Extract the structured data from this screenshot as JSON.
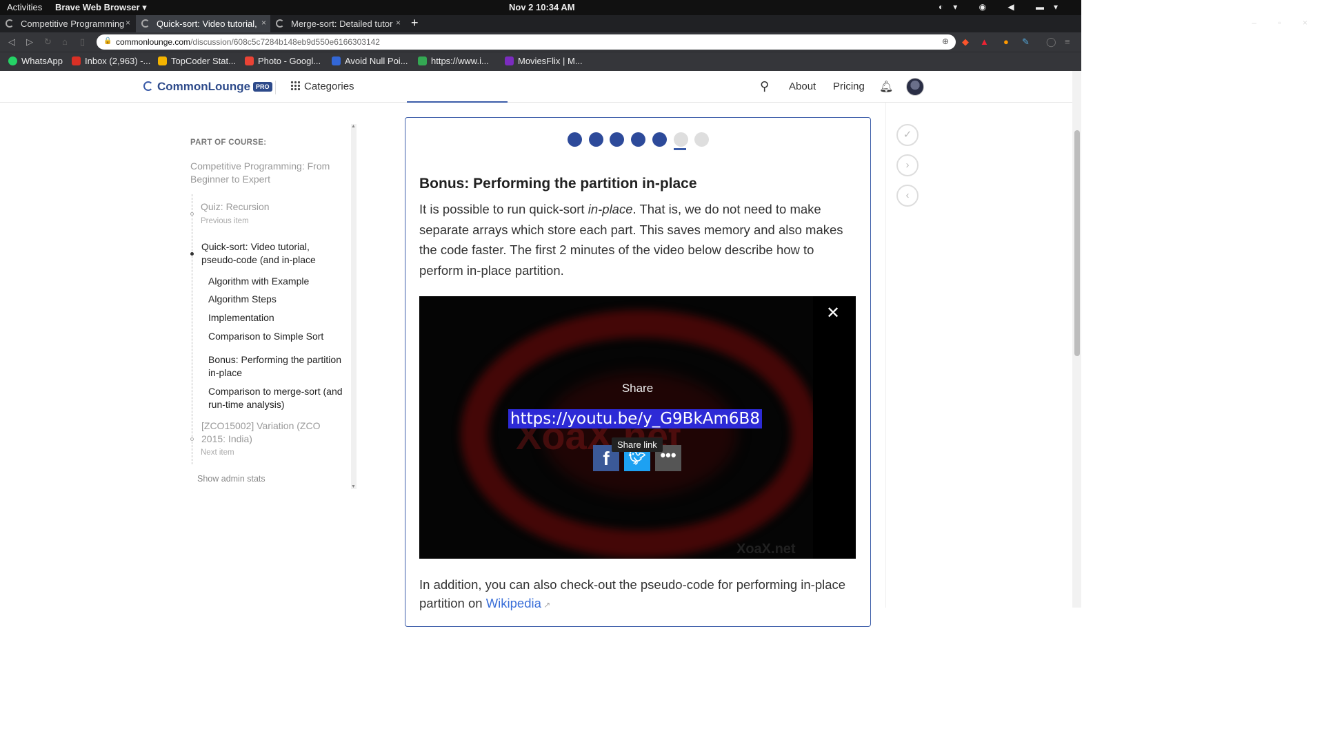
{
  "os": {
    "activities": "Activities",
    "app_menu": "Brave Web Browser ▾",
    "clock": "Nov 2  10:34 AM",
    "tray": "◐▾ ◉ ◀ ▬▾"
  },
  "browser": {
    "tabs": [
      {
        "label": "Competitive Programming",
        "active": false
      },
      {
        "label": "Quick-sort: Video tutorial,",
        "active": true
      },
      {
        "label": "Merge-sort: Detailed tutor",
        "active": false
      }
    ],
    "tab_close": "×",
    "new_tab": "+",
    "window_buttons": "– ▫ ×",
    "url_host": "commonlounge.com",
    "url_path": "/discussion/608c5c7284b148eb9d550e6166303142",
    "bookmarks": [
      {
        "label": "WhatsApp",
        "color": "#25d366"
      },
      {
        "label": "Inbox (2,963) -...",
        "color": "#d93025"
      },
      {
        "label": "TopCoder Stat...",
        "color": "#f4b400"
      },
      {
        "label": "Photo - Googl...",
        "color": "#ea4335"
      },
      {
        "label": "Avoid Null Poi...",
        "color": "#3367d6"
      },
      {
        "label": "https://www.i...",
        "color": "#34a853"
      },
      {
        "label": "MoviesFlix | M...",
        "color": "#7b2cbf"
      }
    ]
  },
  "site": {
    "logo": "CommonLounge",
    "pro_badge": "PRO",
    "categories": "Categories",
    "about": "About",
    "pricing": "Pricing"
  },
  "sidebar": {
    "part_of_course": "PART OF COURSE:",
    "course_title": "Competitive Programming: From Beginner to Expert",
    "prev_item": "Quiz: Recursion",
    "prev_label": "Previous item",
    "current_item": "Quick-sort: Video tutorial, pseudo-code (and in-place",
    "sections": [
      "Algorithm with Example",
      "Algorithm Steps",
      "Implementation",
      "Comparison to Simple Sort",
      "Bonus: Performing the partition in-place",
      "Comparison to merge-sort (and run-time analysis)"
    ],
    "next_item": "[ZCO15002] Variation (ZCO 2015: India)",
    "next_label": "Next item",
    "admin_stats": "Show admin stats"
  },
  "content": {
    "progress_dots": {
      "completed": 5,
      "total": 7,
      "current_index": 5
    },
    "heading": "Bonus: Performing the partition in-place",
    "para_before": "It is possible to run quick-sort ",
    "para_em": "in-place",
    "para_after": ". That is, we do not need to make separate arrays which store each part. This saves memory and also makes the code faster. The first 2 minutes of the video below describe how to perform in-place partition.",
    "video": {
      "share_label": "Share",
      "share_url": "https://youtu.be/y_G9BkAm6B8",
      "tooltip": "Share link",
      "watermark": "XoaX.net"
    },
    "para2_text": "In addition, you can also check-out the pseudo-code for performing in-place partition on ",
    "para2_link": "Wikipedia"
  },
  "colors": {
    "accent": "#3a5ba8",
    "dot_done": "#2d4a9a",
    "dot_todo": "#dedede"
  }
}
